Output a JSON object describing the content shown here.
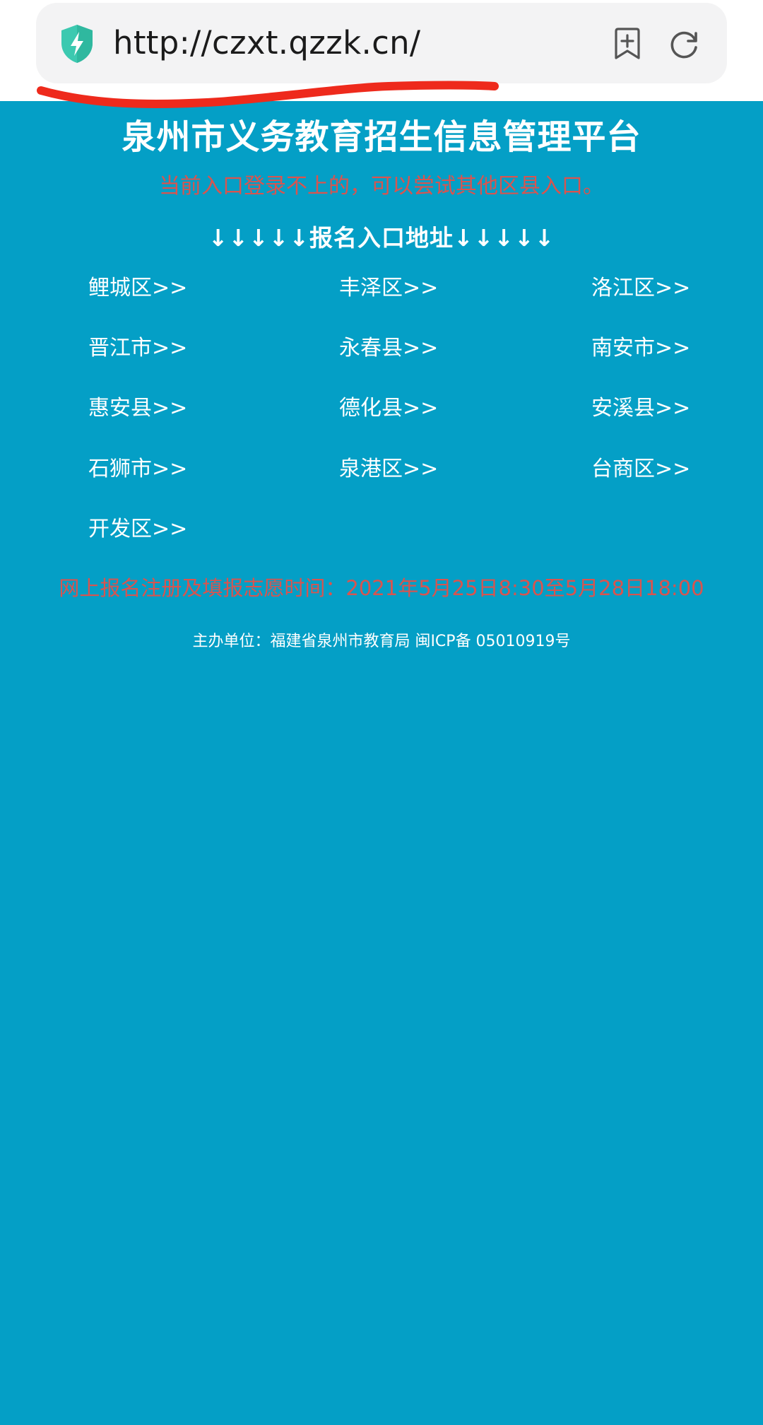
{
  "browser": {
    "url": "http://czxt.qzzk.cn/"
  },
  "page": {
    "title": "泉州市义务教育招生信息管理平台",
    "notice": "当前入口登录不上的，可以尝试其他区县入口。",
    "entry_heading": "↓↓↓↓↓报名入口地址↓↓↓↓↓",
    "districts": [
      "鲤城区>>",
      "丰泽区>>",
      "洛江区>>",
      "晋江市>>",
      "永春县>>",
      "南安市>>",
      "惠安县>>",
      "德化县>>",
      "安溪县>>",
      "石狮市>>",
      "泉港区>>",
      "台商区>>",
      "开发区>>"
    ],
    "schedule": "网上报名注册及填报志愿时间：2021年5月25日8:30至5月28日18:00",
    "footer": "主办单位：福建省泉州市教育局 闽ICP备 05010919号"
  },
  "colors": {
    "page_background": "#049fc6",
    "alert_text": "#d9544f",
    "underline_annotation": "#ee2a1c",
    "shield_accent": "#3cc9b0"
  },
  "icons": [
    "shield-lightning-icon",
    "bookmark-add-icon",
    "reload-icon"
  ]
}
